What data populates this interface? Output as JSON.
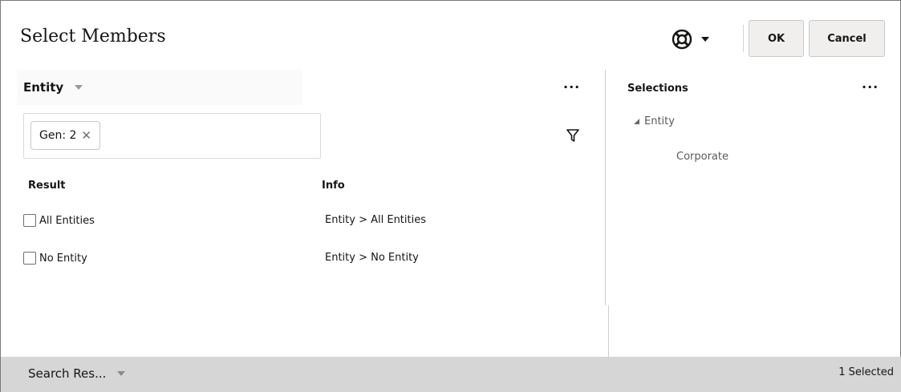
{
  "dialog": {
    "title": "Select Members",
    "help_icon": "lifebuoy-icon",
    "buttons": {
      "ok": "OK",
      "cancel": "Cancel"
    }
  },
  "left_panel": {
    "dimension": "Entity",
    "more_icon": "more-options-icon",
    "more_label": "···",
    "filter_chip": {
      "label": "Gen: 2",
      "remove": "✕"
    },
    "filter_icon": "filter-icon",
    "columns": {
      "result": "Result",
      "info": "Info"
    },
    "rows": [
      {
        "result": "All Entities",
        "info": "Entity > All Entities",
        "checked": false
      },
      {
        "result": "No Entity",
        "info": "Entity > No Entity",
        "checked": false
      }
    ]
  },
  "right_panel": {
    "title": "Selections",
    "more_label": "···",
    "tree": {
      "parent": "Entity",
      "children": [
        "Corporate"
      ]
    }
  },
  "footer": {
    "mode": "Search Res...",
    "selected_count": "1 Selected"
  },
  "colors": {
    "footer_bg": "#d6d6d6",
    "button_bg": "#f1efed",
    "text": "#161513"
  }
}
